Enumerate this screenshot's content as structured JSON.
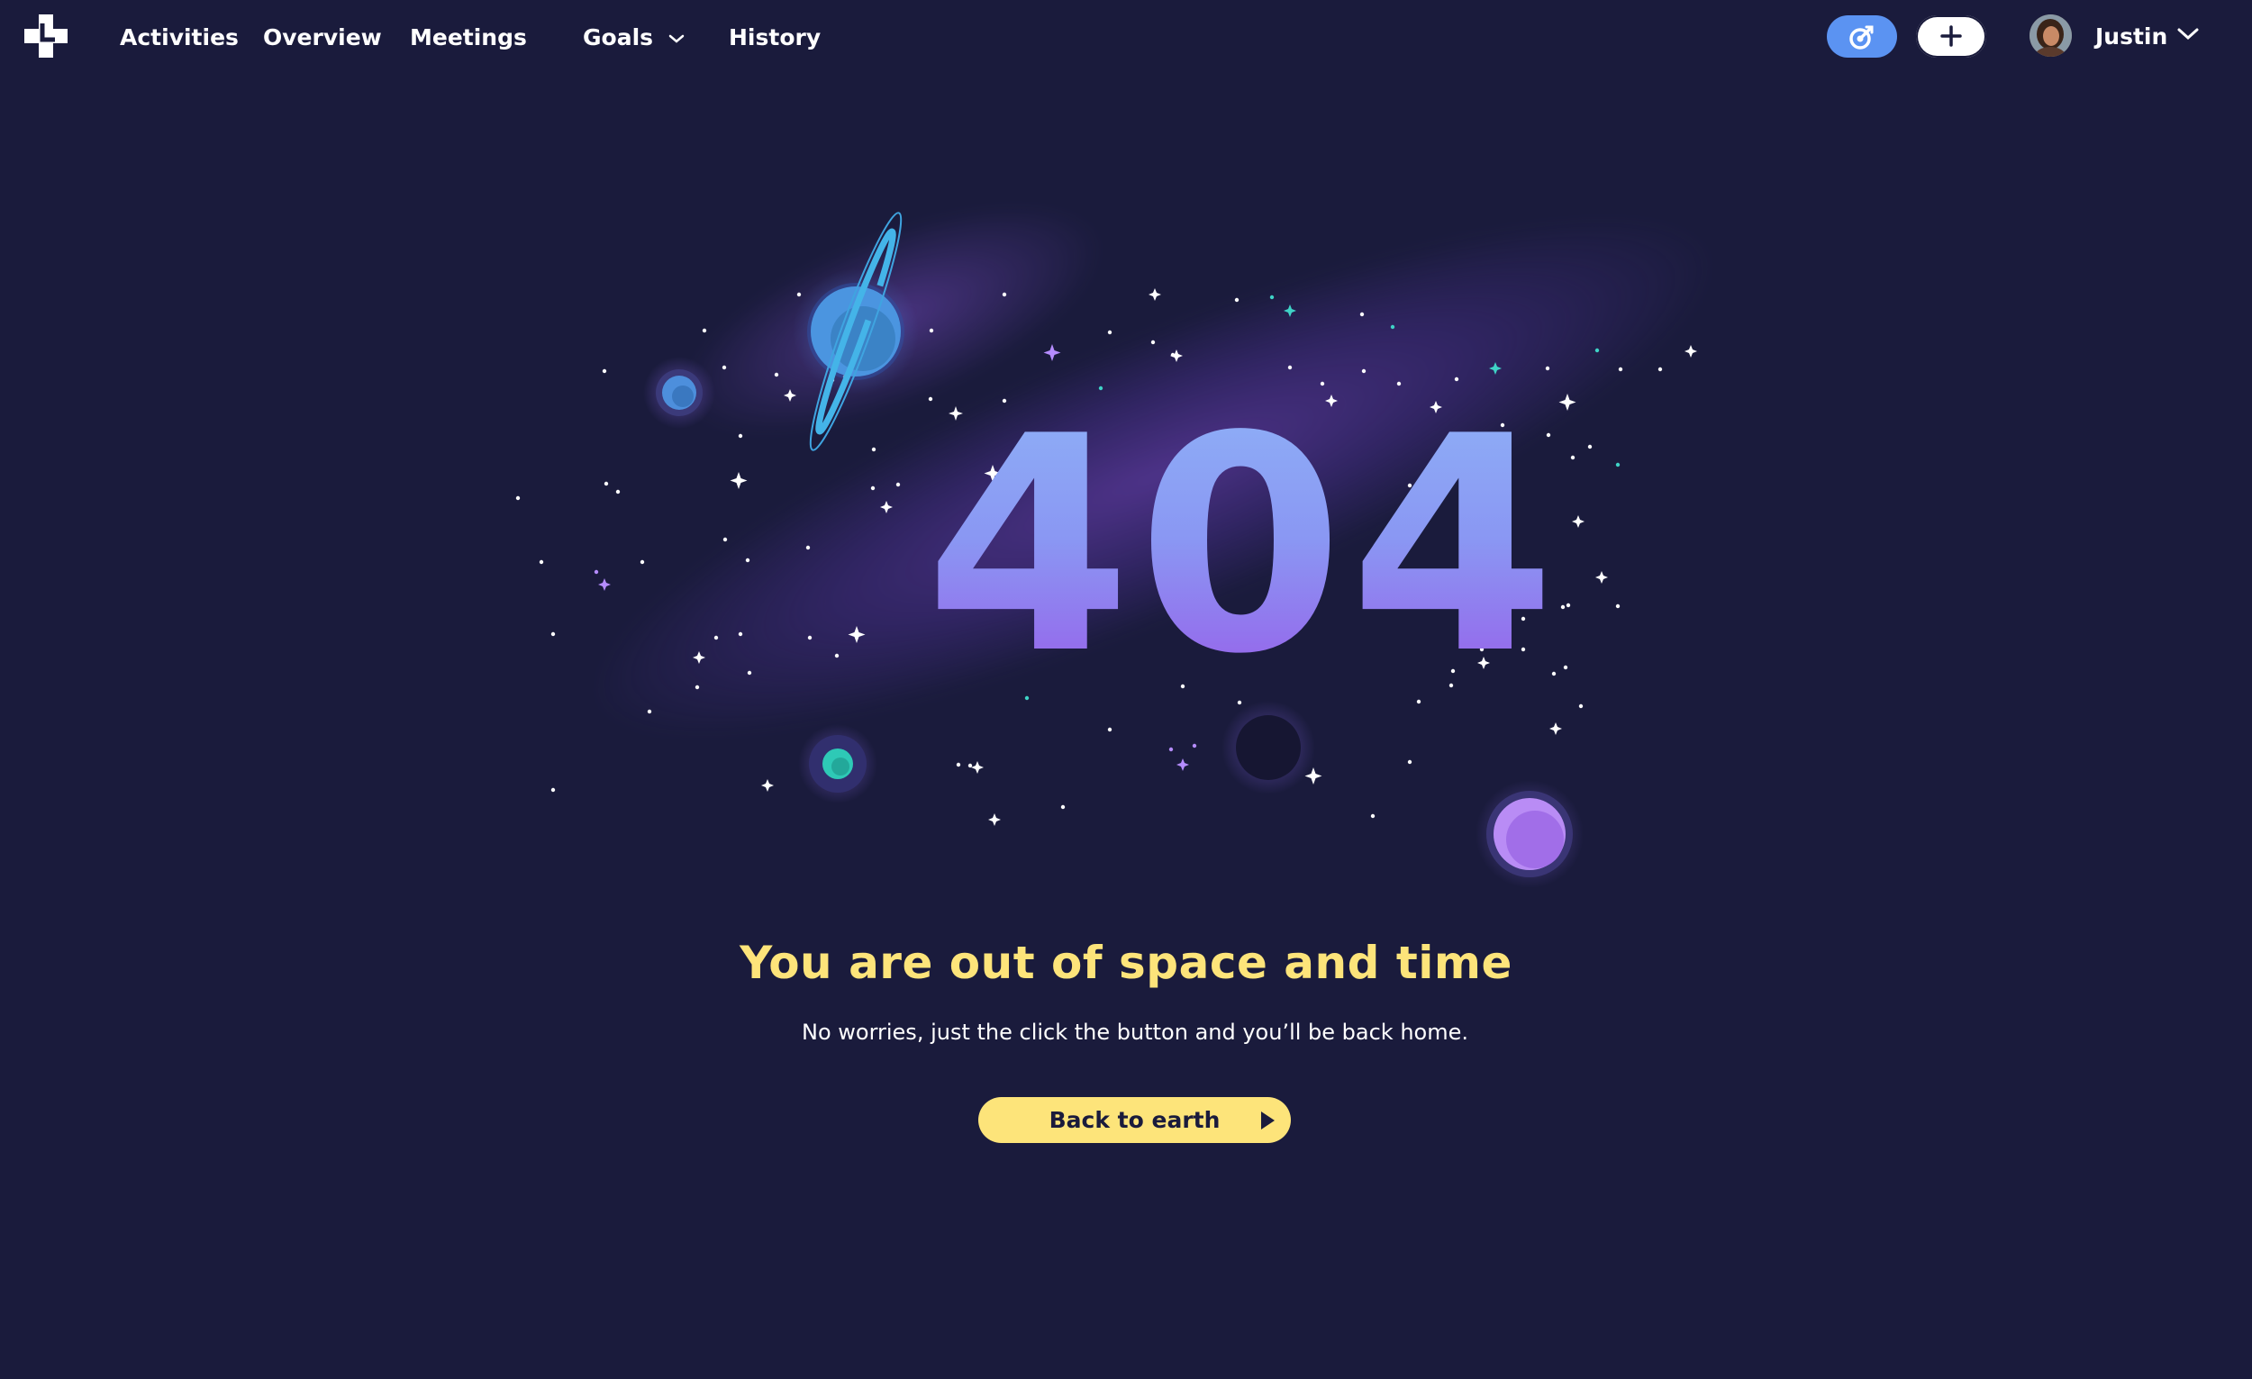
{
  "nav": {
    "logo_icon": "plus-logo-icon",
    "links": [
      {
        "label": "Activities"
      },
      {
        "label": "Overview"
      },
      {
        "label": "Meetings"
      },
      {
        "label": "Goals"
      },
      {
        "label": "History"
      }
    ],
    "focus_button_icon": "target-icon",
    "add_button_icon": "plus-icon",
    "user": {
      "name": "Justin",
      "menu_icon": "chevron-down-icon"
    }
  },
  "error": {
    "code": "404",
    "title": "You are out of space and time",
    "message": "No worries, just the click the button and you’ll be back home.",
    "button_label": "Back to earth",
    "button_icon": "play-icon"
  },
  "colors": {
    "background": "#1a1b3c",
    "title": "#fde47a",
    "button": "#fde47a",
    "accent_blue": "#5b93f2",
    "code_gradient_top": "#8fb4f7",
    "code_gradient_bottom": "#9a55e8"
  }
}
